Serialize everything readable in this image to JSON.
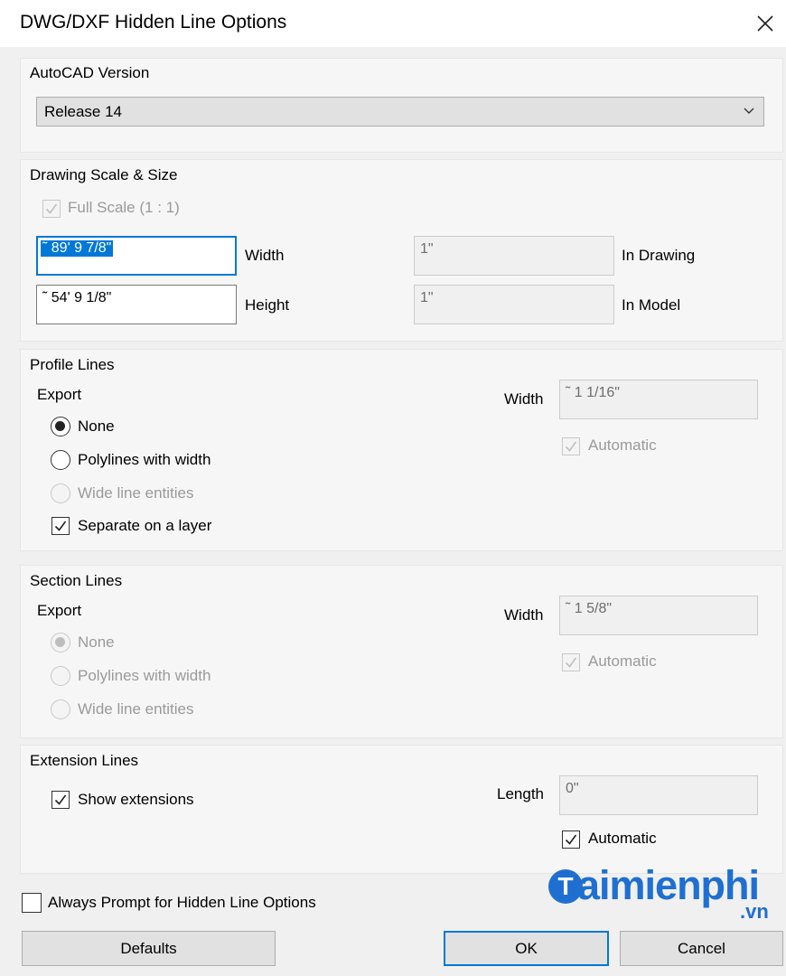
{
  "window": {
    "title": "DWG/DXF Hidden Line Options"
  },
  "autocad": {
    "label": "AutoCAD Version",
    "selected": "Release 14"
  },
  "scale": {
    "label": "Drawing Scale & Size",
    "full_scale_label": "Full Scale (1 : 1)",
    "full_scale_checked": true,
    "width_value": "˜ 89' 9 7/8\"",
    "width_label": "Width",
    "height_value": "˜ 54' 9 1/8\"",
    "height_label": "Height",
    "in_drawing_value": "1\"",
    "in_drawing_label": "In Drawing",
    "in_model_value": "1\"",
    "in_model_label": "In Model"
  },
  "profile": {
    "label": "Profile Lines",
    "export_label": "Export",
    "options": [
      "None",
      "Polylines with width",
      "Wide line entities"
    ],
    "selected": "None",
    "separate_label": "Separate on a layer",
    "separate_checked": true,
    "width_label": "Width",
    "width_value": "˜ 1 1/16\"",
    "automatic_label": "Automatic",
    "automatic_checked": true
  },
  "section": {
    "label": "Section Lines",
    "export_label": "Export",
    "options": [
      "None",
      "Polylines with width",
      "Wide line entities"
    ],
    "selected": "None",
    "width_label": "Width",
    "width_value": "˜ 1 5/8\"",
    "automatic_label": "Automatic",
    "automatic_checked": true
  },
  "extension": {
    "label": "Extension Lines",
    "show_label": "Show extensions",
    "show_checked": true,
    "length_label": "Length",
    "length_value": "0\"",
    "automatic_label": "Automatic",
    "automatic_checked": true
  },
  "footer": {
    "always_prompt_label": "Always Prompt for Hidden Line Options",
    "always_prompt_checked": false,
    "defaults_label": "Defaults",
    "ok_label": "OK",
    "cancel_label": "Cancel"
  },
  "watermark": {
    "text": "aimienphi",
    "suffix": ".vn",
    "icon_letter": "T"
  },
  "colors": {
    "accent": "#0078d7",
    "watermark": "#1f6fd1"
  },
  "icons": {
    "close": "close-icon",
    "dropdown": "chevron-down-icon",
    "check": "check-icon"
  }
}
